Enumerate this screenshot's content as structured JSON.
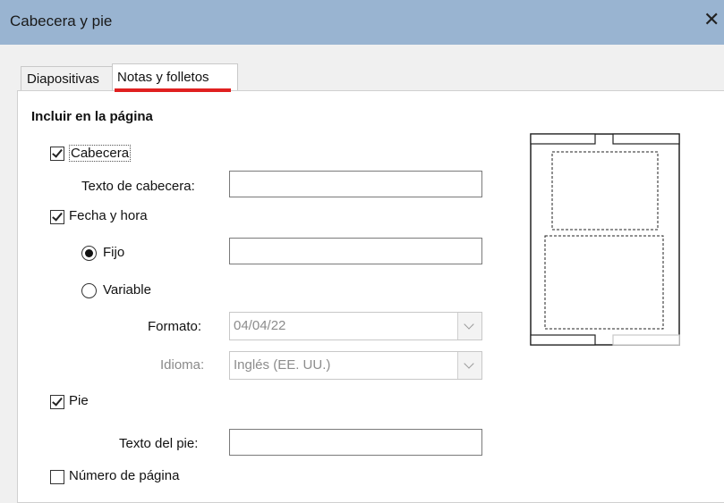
{
  "window": {
    "title": "Cabecera y pie",
    "close_glyph": "✕"
  },
  "tabs": [
    {
      "label": "Diapositivas",
      "selected": false
    },
    {
      "label": "Notas y folletos",
      "selected": true
    }
  ],
  "section_heading": "Incluir en la página",
  "header": {
    "checkbox_label": "Cabecera",
    "checked": true,
    "text_label": "Texto de cabecera:",
    "text_value": ""
  },
  "datetime": {
    "checkbox_label": "Fecha y hora",
    "checked": true,
    "fixed_label": "Fijo",
    "fixed_selected": true,
    "fixed_value": "",
    "variable_label": "Variable",
    "variable_selected": false,
    "format_label": "Formato:",
    "format_value": "04/04/22",
    "language_label": "Idioma:",
    "language_value": "Inglés (EE. UU.)"
  },
  "footer": {
    "checkbox_label": "Pie",
    "checked": true,
    "text_label": "Texto del pie:",
    "text_value": ""
  },
  "page_number": {
    "checkbox_label": "Número de página",
    "checked": false
  },
  "icons": {
    "close": "close-icon",
    "chevron": "chevron-down-icon"
  }
}
